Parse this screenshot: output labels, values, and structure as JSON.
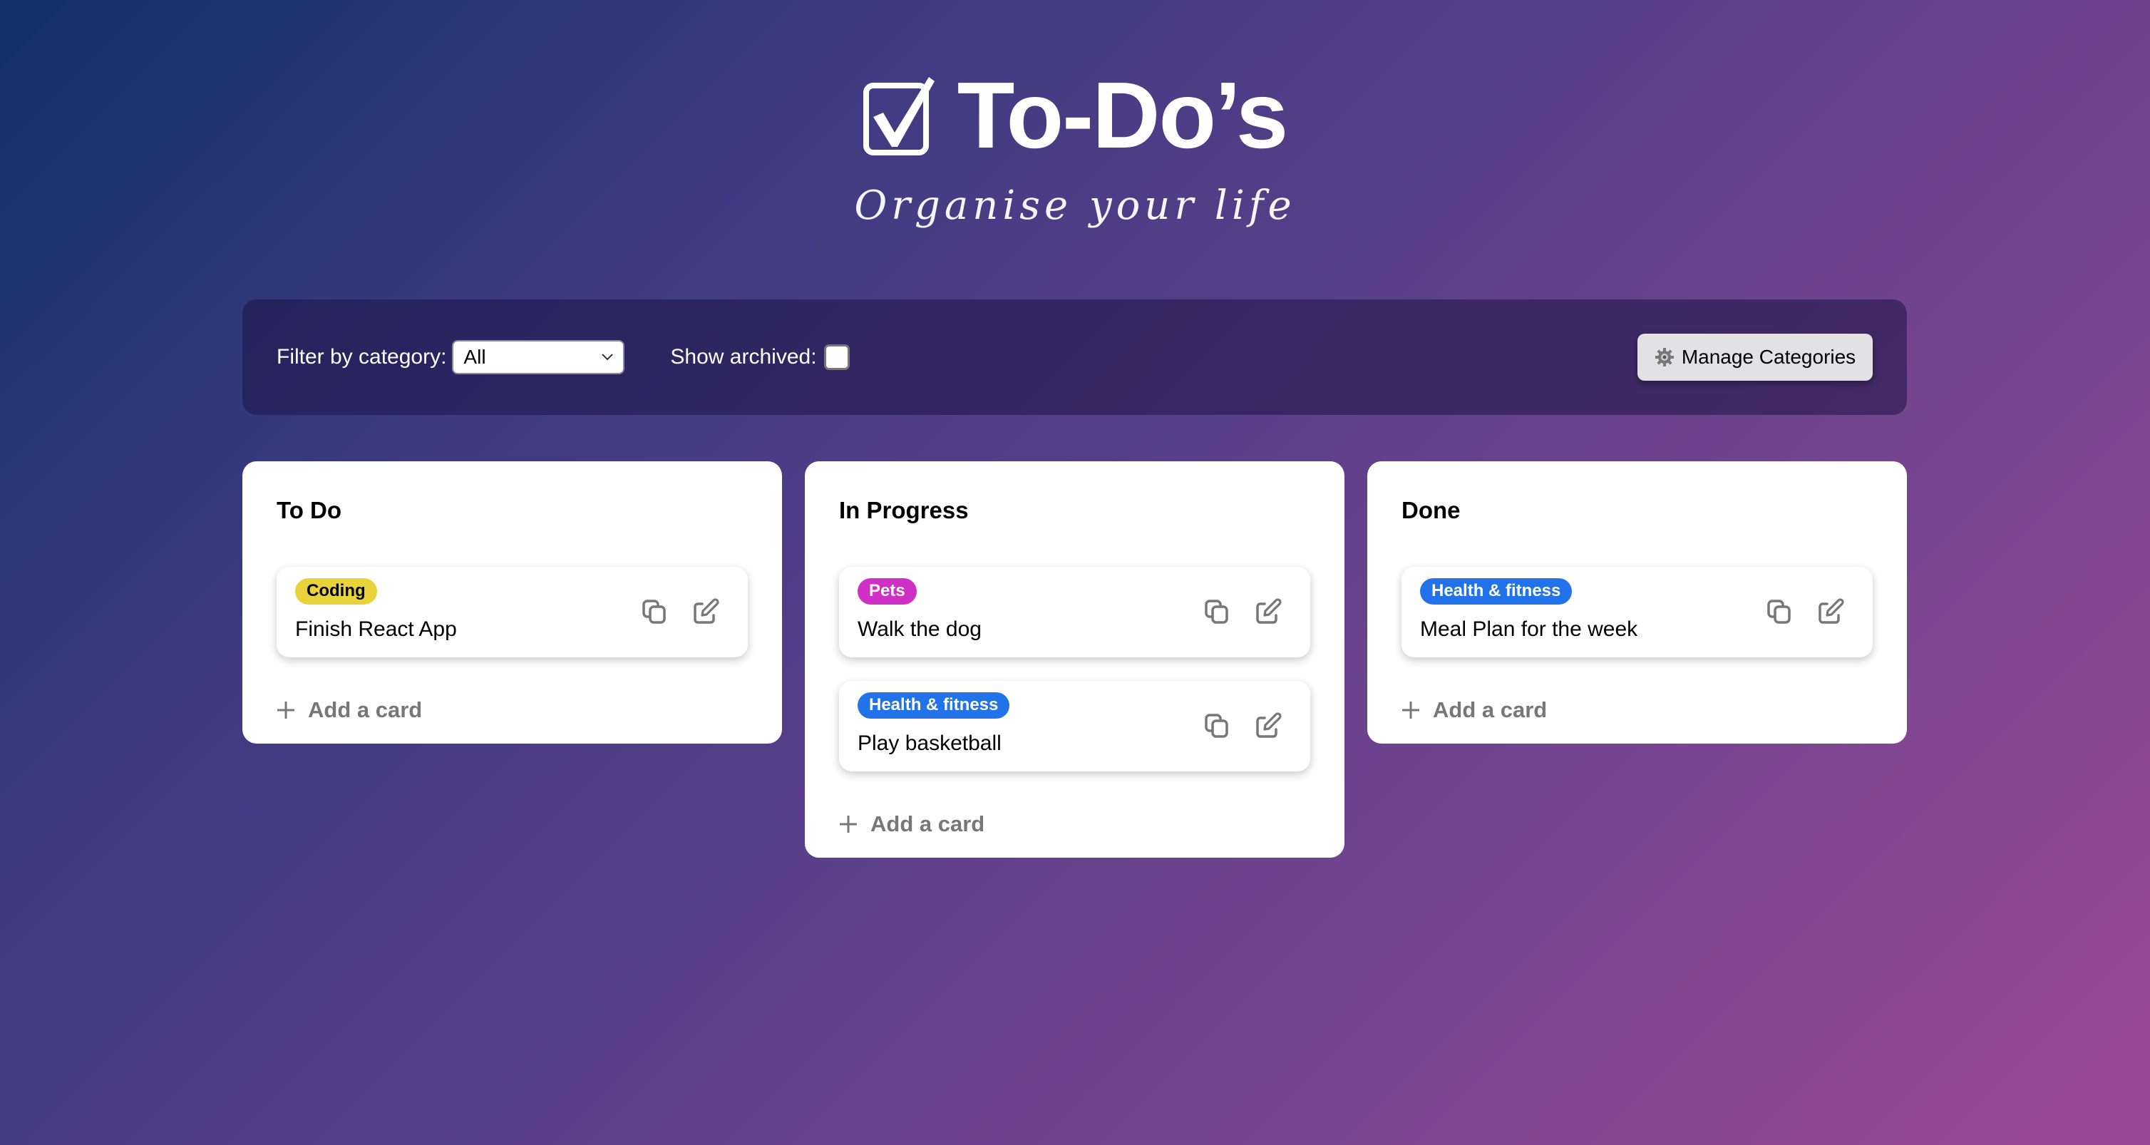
{
  "header": {
    "logo_icon": "checkbox-checked-icon",
    "title": "To-Do’s",
    "subtitle": "Organise your life"
  },
  "toolbar": {
    "filter_label": "Filter by category:",
    "filter_value": "All",
    "show_archived_label": "Show archived:",
    "show_archived_checked": false,
    "manage_categories_label": "Manage Categories",
    "manage_categories_icon": "gear-icon"
  },
  "columns": [
    {
      "title": "To Do",
      "cards": [
        {
          "category": "Coding",
          "category_color": "#e8d43a",
          "category_text_color": "#000000",
          "text": "Finish React App"
        }
      ],
      "add_label": "Add a card"
    },
    {
      "title": "In Progress",
      "cards": [
        {
          "category": "Pets",
          "category_color": "#d02fc6",
          "category_text_color": "#ffffff",
          "text": "Walk the dog"
        },
        {
          "category": "Health & fitness",
          "category_color": "#2272ea",
          "category_text_color": "#ffffff",
          "text": "Play basketball"
        }
      ],
      "add_label": "Add a card"
    },
    {
      "title": "Done",
      "cards": [
        {
          "category": "Health & fitness",
          "category_color": "#2272ea",
          "category_text_color": "#ffffff",
          "text": "Meal Plan for the week"
        }
      ],
      "add_label": "Add a card"
    }
  ],
  "card_actions": {
    "copy_icon": "copy-icon",
    "edit_icon": "edit-icon"
  }
}
